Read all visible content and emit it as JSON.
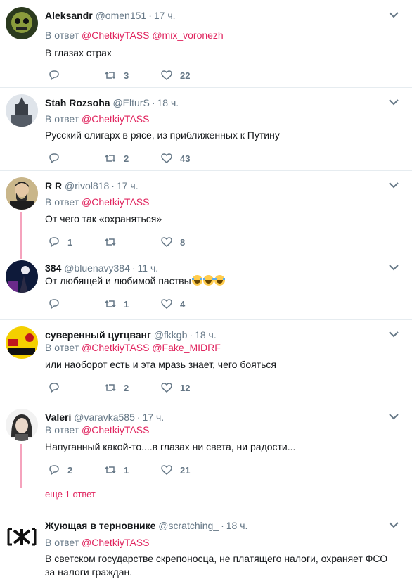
{
  "colors": {
    "accent": "#e0245e",
    "muted": "#657786",
    "text": "#14171a",
    "thread_line": "#f5a3bd"
  },
  "reply_prefix": "В ответ",
  "tweets": [
    {
      "name": "Aleksandr",
      "handle": "@omen151",
      "time": "17 ч.",
      "mentions": [
        "@ChetkiyTASS",
        "@mix_voronezh"
      ],
      "text": "В глазах страх",
      "replies": "",
      "retweets": "3",
      "likes": "22"
    },
    {
      "name": "Stah Rozsoha",
      "handle": "@ElturS",
      "time": "18 ч.",
      "mentions": [
        "@ChetkiyTASS"
      ],
      "text": "Русский олигарх в рясе, из приближенных к Путину",
      "replies": "",
      "retweets": "2",
      "likes": "43"
    },
    {
      "name": "R R",
      "handle": "@rivol818",
      "time": "17 ч.",
      "mentions": [
        "@ChetkiyTASS"
      ],
      "text": "От чего так «охраняться»",
      "replies": "1",
      "retweets": "",
      "likes": "8"
    },
    {
      "name": "384",
      "handle": "@bluenavy384",
      "time": "11 ч.",
      "mentions": [],
      "text": "От любящей и любимой паствы",
      "emoji": "face-with-tears-of-joy x3",
      "replies": "",
      "retweets": "1",
      "likes": "4"
    },
    {
      "name": "суверенный цугцванг",
      "handle": "@fkkgb",
      "time": "18 ч.",
      "mentions": [
        "@ChetkiyTASS",
        "@Fake_MIDRF"
      ],
      "text": "или наоборот есть и эта мразь знает, чего бояться",
      "replies": "",
      "retweets": "2",
      "likes": "12"
    },
    {
      "name": "Valeri",
      "handle": "@varavka585",
      "time": "17 ч.",
      "mentions": [
        "@ChetkiyTASS"
      ],
      "text": "Напуганный какой-то....в глазах ни света, ни радости...",
      "replies": "2",
      "retweets": "1",
      "likes": "21",
      "more_replies": "еще 1 ответ"
    },
    {
      "name": "Жующая в терновнике",
      "handle": "@scratching_",
      "time": "18 ч.",
      "mentions": [
        "@ChetkiyTASS"
      ],
      "text": "В светском государстве скрепоносца, не платящего налоги, охраняет ФСО за налоги граждан."
    }
  ]
}
